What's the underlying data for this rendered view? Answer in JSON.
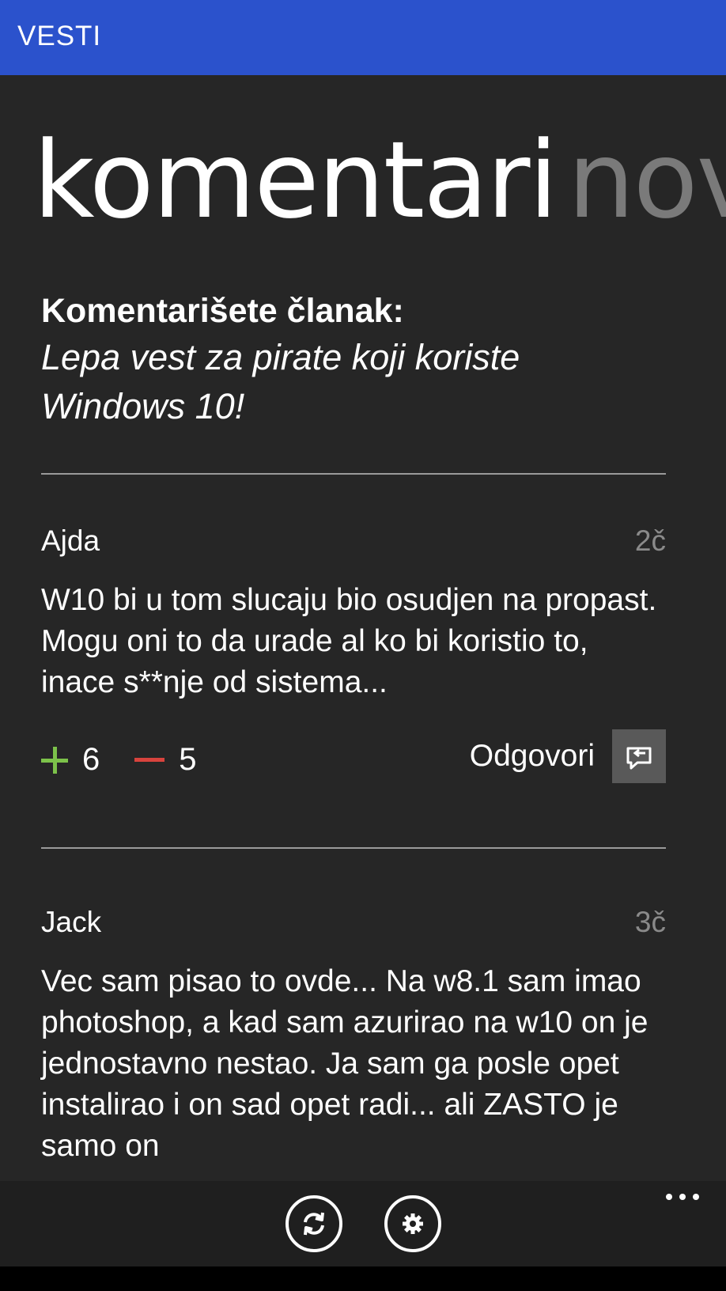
{
  "app": {
    "title": "VESTI"
  },
  "pivot": {
    "active": "komentari",
    "next": "nov"
  },
  "article": {
    "heading": "Komentarišete članak:",
    "title": "Lepa vest za pirate koji koriste Windows 10!"
  },
  "comments": [
    {
      "author": "Ajda",
      "time": "2č",
      "text": "W10 bi u tom slucaju bio osudjen na propast. Mogu oni to da urade al ko bi koristio to, inace s**nje od sistema...",
      "upvotes": "6",
      "downvotes": "5",
      "reply_label": "Odgovori"
    },
    {
      "author": "Jack",
      "time": "3č",
      "text": "Vec sam pisao to ovde... Na w8.1 sam imao photoshop, a kad sam azurirao na w10 on je jednostavno nestao. Ja sam ga posle opet instalirao i on sad opet radi... ali ZASTO je samo on"
    }
  ],
  "appbar": {
    "buttons": [
      {
        "icon": "refresh-icon"
      },
      {
        "icon": "settings-gear-icon"
      }
    ],
    "more_icon": "more-ellipsis-icon"
  },
  "colors": {
    "titlebar": "#2b52cc",
    "background": "#262626",
    "upvote": "#7cc24a",
    "downvote": "#d8433d"
  }
}
